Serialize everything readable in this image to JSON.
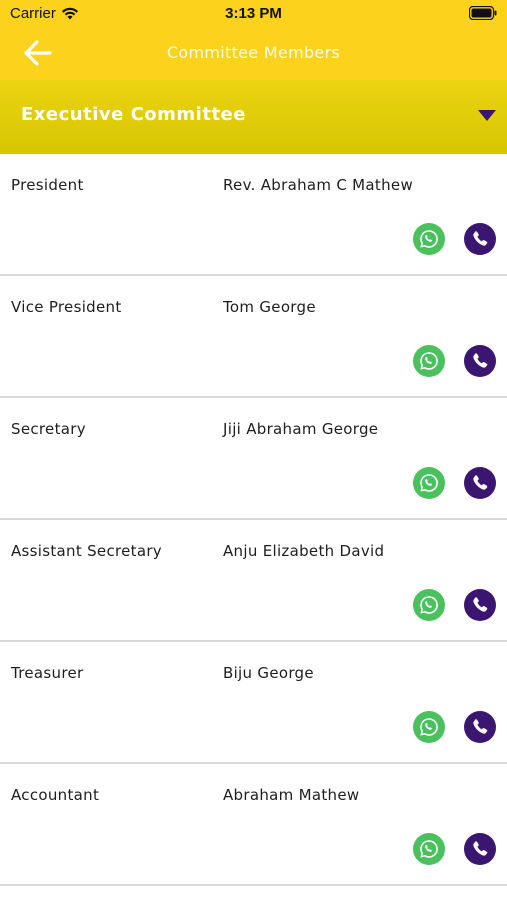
{
  "status": {
    "carrier": "Carrier",
    "time": "3:13 PM"
  },
  "header": {
    "title": "Committee Members"
  },
  "dropdown": {
    "selected": "Executive Committee"
  },
  "members": [
    {
      "role": "President",
      "name": "Rev. Abraham C Mathew"
    },
    {
      "role": "Vice President",
      "name": "Tom George"
    },
    {
      "role": "Secretary",
      "name": "Jiji Abraham George"
    },
    {
      "role": "Assistant Secretary",
      "name": "Anju Elizabeth David"
    },
    {
      "role": "Treasurer",
      "name": "Biju George"
    },
    {
      "role": "Accountant",
      "name": "Abraham Mathew"
    }
  ],
  "icons": {
    "whatsapp": "whatsapp-icon",
    "call": "phone-icon",
    "back": "back-arrow-icon",
    "caret": "caret-down-icon"
  },
  "colors": {
    "brand_yellow": "#fcd21c",
    "whatsapp_green": "#4bc15e",
    "call_purple": "#3a1670"
  }
}
